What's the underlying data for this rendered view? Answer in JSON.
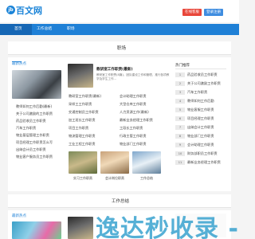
{
  "header": {
    "logo_badge": "jb",
    "logo_text": "百文网",
    "btn_red": "在线客服",
    "btn_blue": "登录注册"
  },
  "nav": {
    "items": [
      "首页",
      "工作总结",
      "职场"
    ]
  },
  "section1": {
    "title": "职场",
    "left_tag": "最新热点",
    "left_items": [
      "教师如何工作后勤(最新)",
      "关于公司激励的工作职责",
      "药品验收员工作职责",
      "汽车工作职责",
      "物业基层管理工作职责",
      "项目经理工作职责怎么写",
      "出纳会计员工作职责",
      "物业客户服务员工作职责"
    ],
    "feature_title": "教研室工作职责(最新)",
    "feature_desc": "教研室工作职责(8篇)，团队建设工作和管理，推行各项教学及学生工作...",
    "mid_list": [
      [
        "教研室工作职责(最新)",
        "会计助理工作职责"
      ],
      [
        "采样工工作职责",
        "大型仓库工作职责"
      ],
      [
        "交通控制员工作职责",
        "人力资源工作(最新)"
      ],
      [
        "加工班长工作职责",
        "最新业务经理工作职责"
      ],
      [
        "项目工作职责",
        "工段长工作职责"
      ],
      [
        "物流管理工作职责",
        "行政主管工作职责"
      ],
      [
        "工业工程工作职责",
        "物业部门工作职责"
      ]
    ],
    "thumb_captions": [
      "实习工作职责",
      "会计岗位职责",
      "工作总结"
    ],
    "right_tag": "热门推荐",
    "right_items": [
      "药品验收员工作职责",
      "关于公司激励工作职责",
      "汽车工作职责",
      "教师如何工作后勤",
      "物业客服工作职责",
      "项目经理工作职责",
      "出纳会计工作职责",
      "物业部门工作职责",
      "会计助理工作职责",
      "财务部职员工作职责",
      "最新业务经理工作职责"
    ]
  },
  "section2": {
    "title": "工作总结",
    "left_tag": "最新热点",
    "watermark": "逸达秒收录 - 村"
  }
}
